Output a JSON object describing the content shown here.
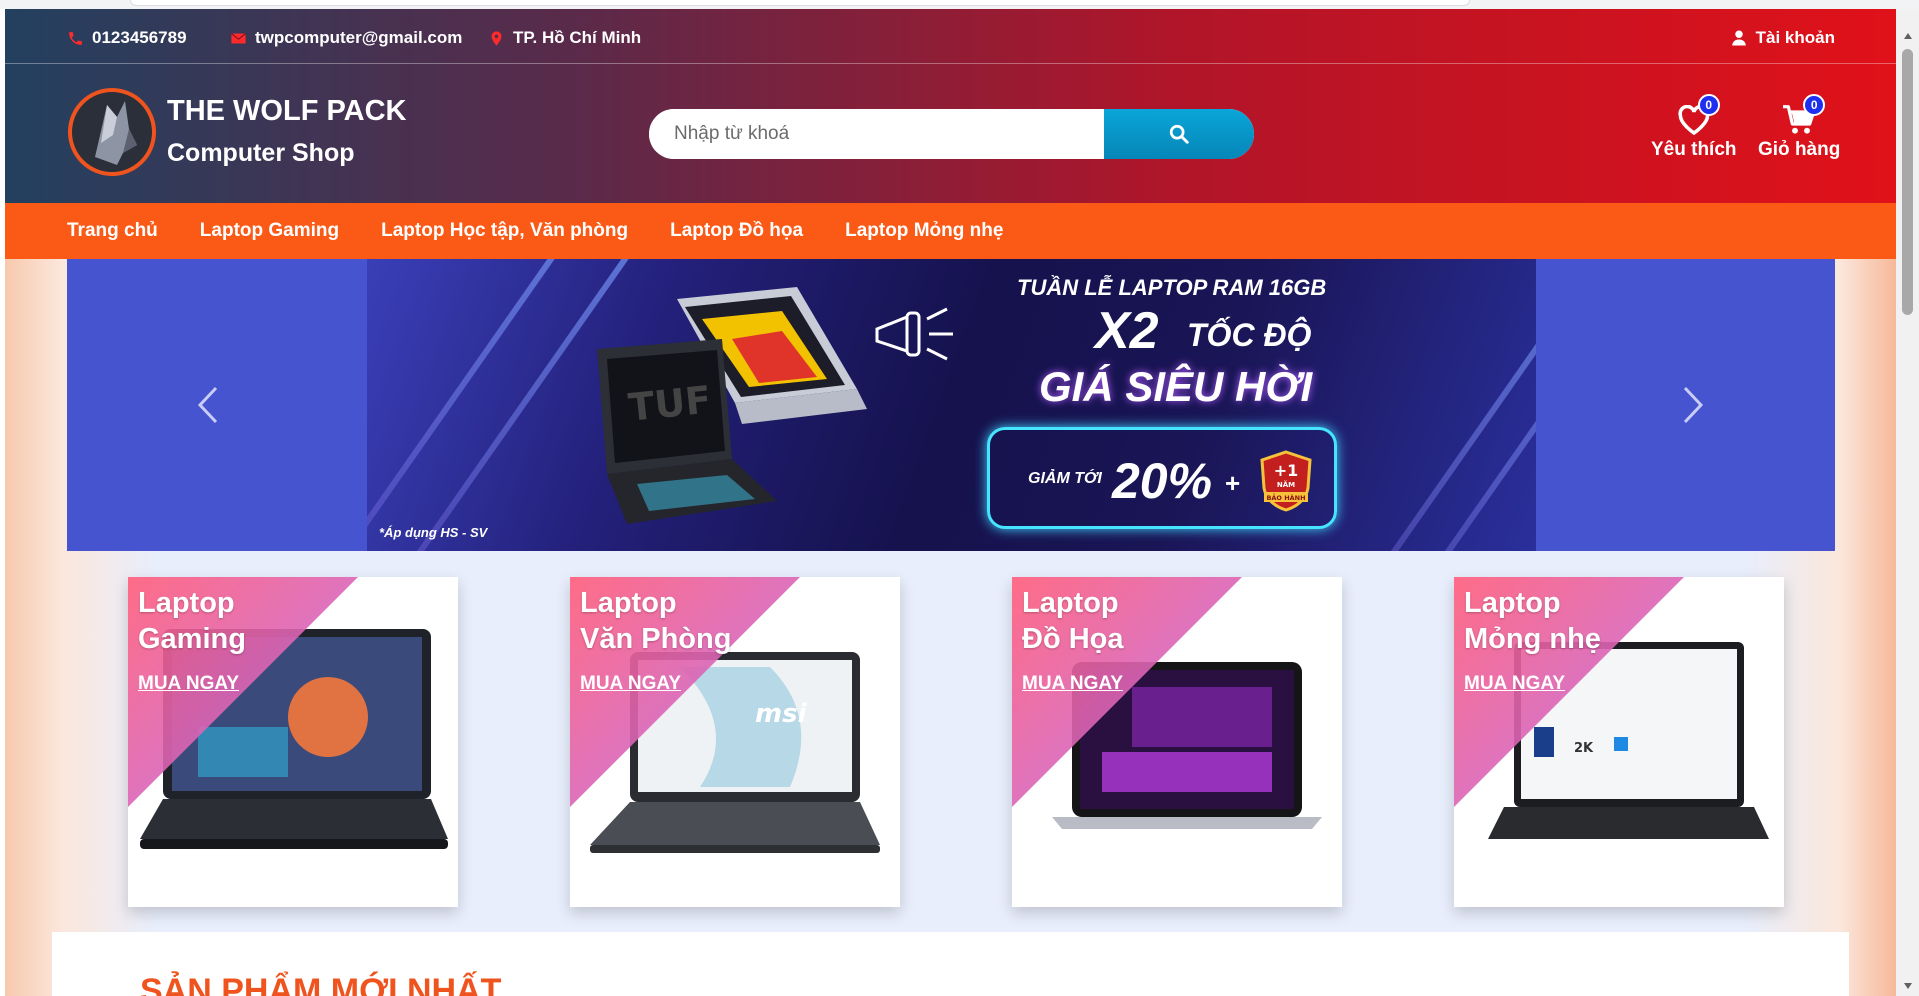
{
  "colors": {
    "header_start": "#23405f",
    "header_end": "#e01119",
    "nav_bg": "#fb5a16",
    "search_btn": "#0aa5d8",
    "badge": "#1e2ff0",
    "section_title": "#f0541e"
  },
  "topbar": {
    "phone": {
      "icon": "phone-icon",
      "text": "0123456789"
    },
    "email": {
      "icon": "mail-icon",
      "text": "twpcomputer@gmail.com"
    },
    "location": {
      "icon": "map-pin-icon",
      "text": "TP. Hồ Chí Minh"
    },
    "account": {
      "icon": "user-icon",
      "label": "Tài khoản"
    }
  },
  "brand": {
    "line1": "THE WOLF PACK",
    "line2": "Computer Shop",
    "logo_icon": "wolf-logo-icon"
  },
  "search": {
    "placeholder": "Nhập từ khoá",
    "value": "",
    "button_icon": "search-icon"
  },
  "header_actions": {
    "wishlist": {
      "icon": "heart-icon",
      "label": "Yêu thích",
      "count": "0"
    },
    "cart": {
      "icon": "cart-icon",
      "label": "Giỏ hàng",
      "count": "0"
    }
  },
  "nav": {
    "items": [
      {
        "label": "Trang chủ"
      },
      {
        "label": "Laptop Gaming"
      },
      {
        "label": "Laptop Học tập, Văn phòng"
      },
      {
        "label": "Laptop Đồ họa"
      },
      {
        "label": "Laptop Mỏng nhẹ"
      }
    ]
  },
  "banner": {
    "line1": "TUẦN LỄ LAPTOP RAM 16GB",
    "line2a": "X2",
    "line2b": "TỐC ĐỘ",
    "line3": "GIÁ SIÊU HỜI",
    "deal_label": "GIẢM TỚI",
    "deal_value": "20%",
    "deal_plus": "+",
    "warranty": {
      "line1": "+1",
      "line2": "NĂM",
      "line3": "BẢO HÀNH"
    },
    "note": "*Áp dụng HS - SV",
    "prev_icon": "chevron-left-icon",
    "next_icon": "chevron-right-icon"
  },
  "categories": [
    {
      "line1": "Laptop",
      "line2": "Gaming",
      "cta": "MUA NGAY"
    },
    {
      "line1": "Laptop",
      "line2": "Văn Phòng",
      "cta": "MUA NGAY"
    },
    {
      "line1": "Laptop",
      "line2": "Đồ Họa",
      "cta": "MUA NGAY"
    },
    {
      "line1": "Laptop",
      "line2": "Mỏng nhẹ",
      "cta": "MUA NGAY"
    }
  ],
  "sections": {
    "newest_title": "SẢN PHẨM MỚI NHẤT"
  }
}
